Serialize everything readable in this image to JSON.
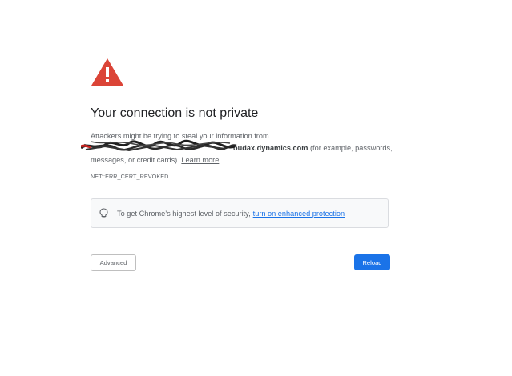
{
  "page": {
    "title": "Your connection is not private",
    "message_before": "Attackers might be trying to steal your information from ",
    "domain_visible": "oudax.dynamics.com",
    "message_after": " (for example, passwords, messages, or credit cards). ",
    "learn_more": "Learn more",
    "error_code": "NET::ERR_CERT_REVOKED"
  },
  "enhanced_protection": {
    "text": "To get Chrome’s highest level of security,",
    "link": "turn on enhanced protection"
  },
  "buttons": {
    "advanced": "Advanced",
    "reload": "Reload"
  },
  "icons": {
    "warning": "warning-triangle-icon",
    "bulb": "lightbulb-icon"
  },
  "colors": {
    "warning_red": "#db4437",
    "link_blue": "#1a73e8",
    "primary_button": "#1a73e8",
    "title_text": "#202124",
    "body_text": "#5f6368"
  }
}
